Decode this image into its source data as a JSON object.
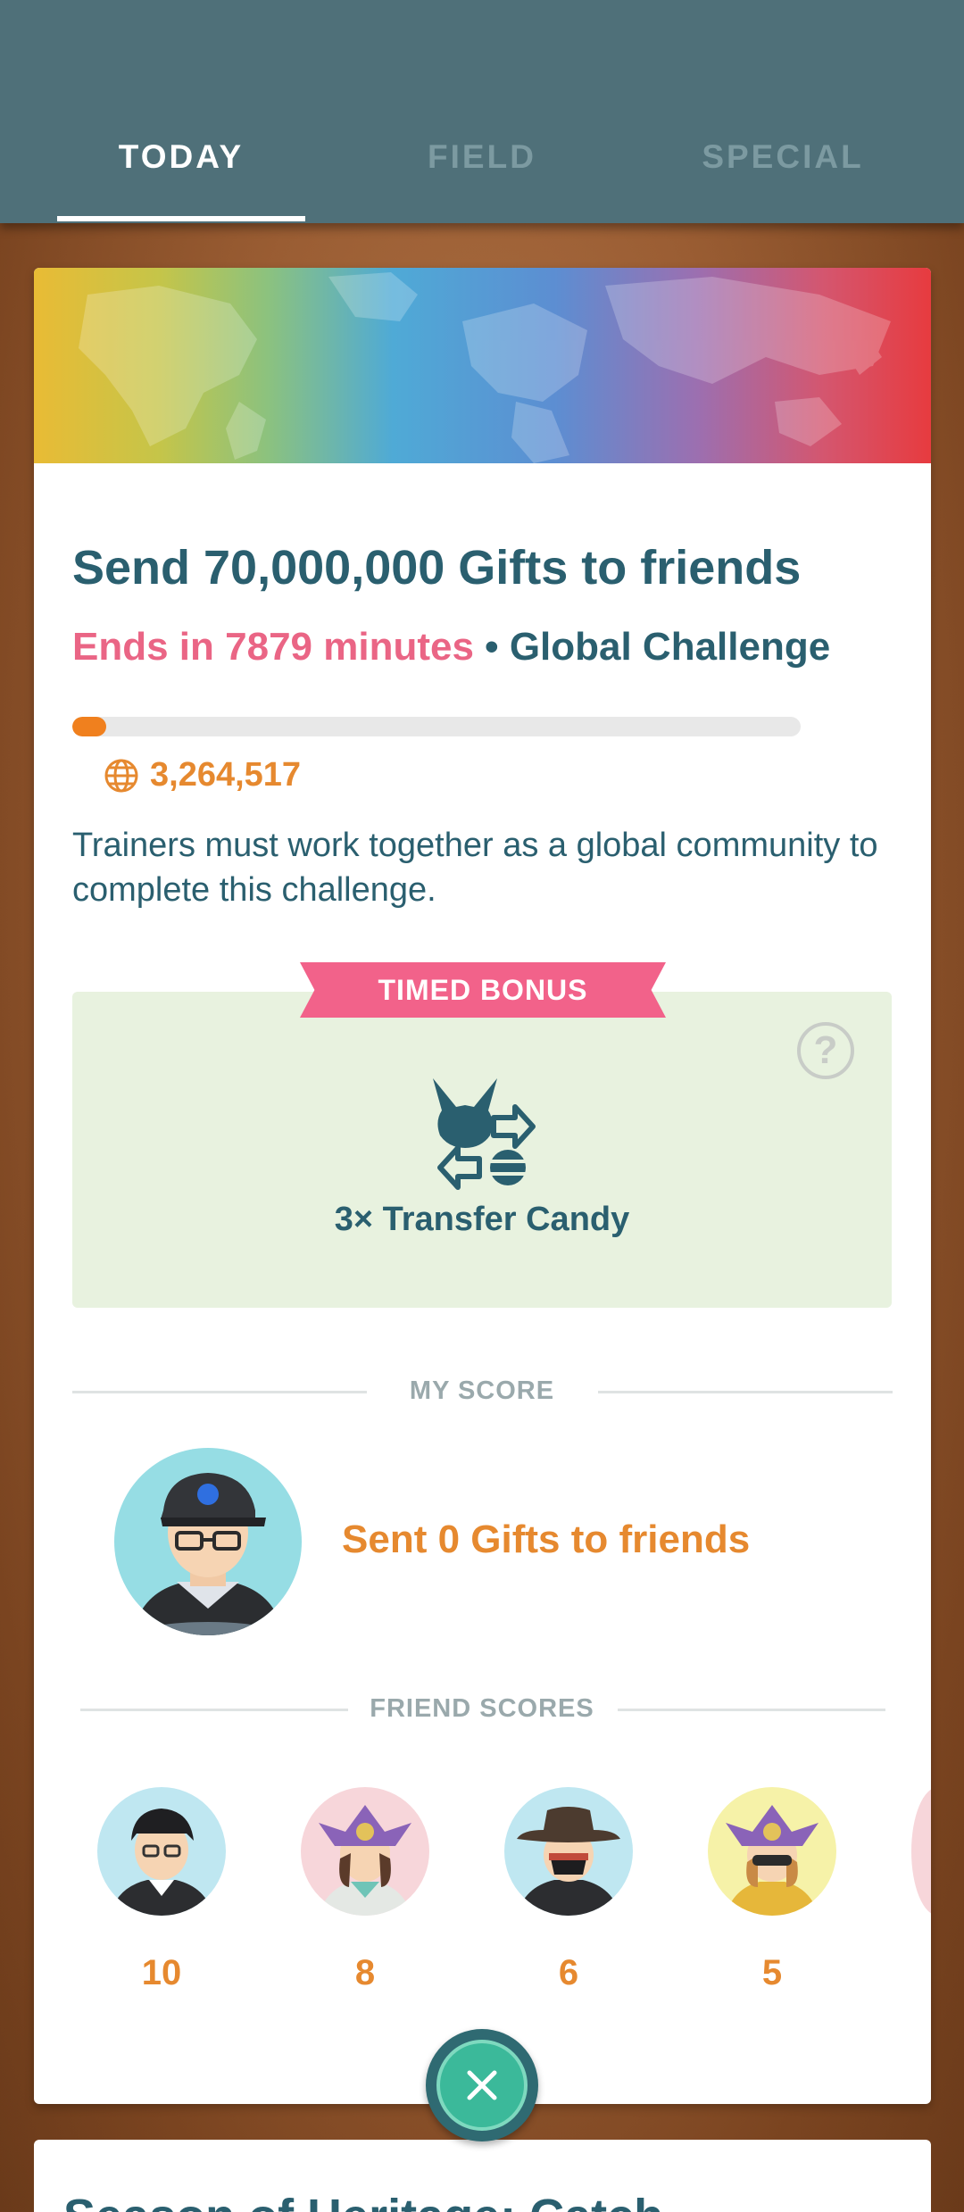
{
  "tabs": [
    {
      "label": "TODAY",
      "active": true
    },
    {
      "label": "FIELD",
      "active": false
    },
    {
      "label": "SPECIAL",
      "active": false
    }
  ],
  "challenge": {
    "title": "Send 70,000,000 Gifts to friends",
    "ends": "Ends in 7879 minutes",
    "separator": "•",
    "type": "Global Challenge",
    "progress_fraction": 0.047,
    "global_count": "3,264,517",
    "description": "Trainers must work together as a global community to complete this challenge.",
    "accent_color": "#f0801e"
  },
  "bonus": {
    "ribbon": "TIMED BONUS",
    "help": "?",
    "label": "3× Transfer Candy",
    "icon": "transfer-candy-icon"
  },
  "my_score": {
    "heading": "MY SCORE",
    "text": "Sent 0 Gifts to friends"
  },
  "friend_scores": {
    "heading": "FRIEND SCORES",
    "friends": [
      {
        "score": "10"
      },
      {
        "score": "8"
      },
      {
        "score": "6"
      },
      {
        "score": "5"
      }
    ]
  },
  "next_card": {
    "title": "Season of Heritage: Catch"
  }
}
